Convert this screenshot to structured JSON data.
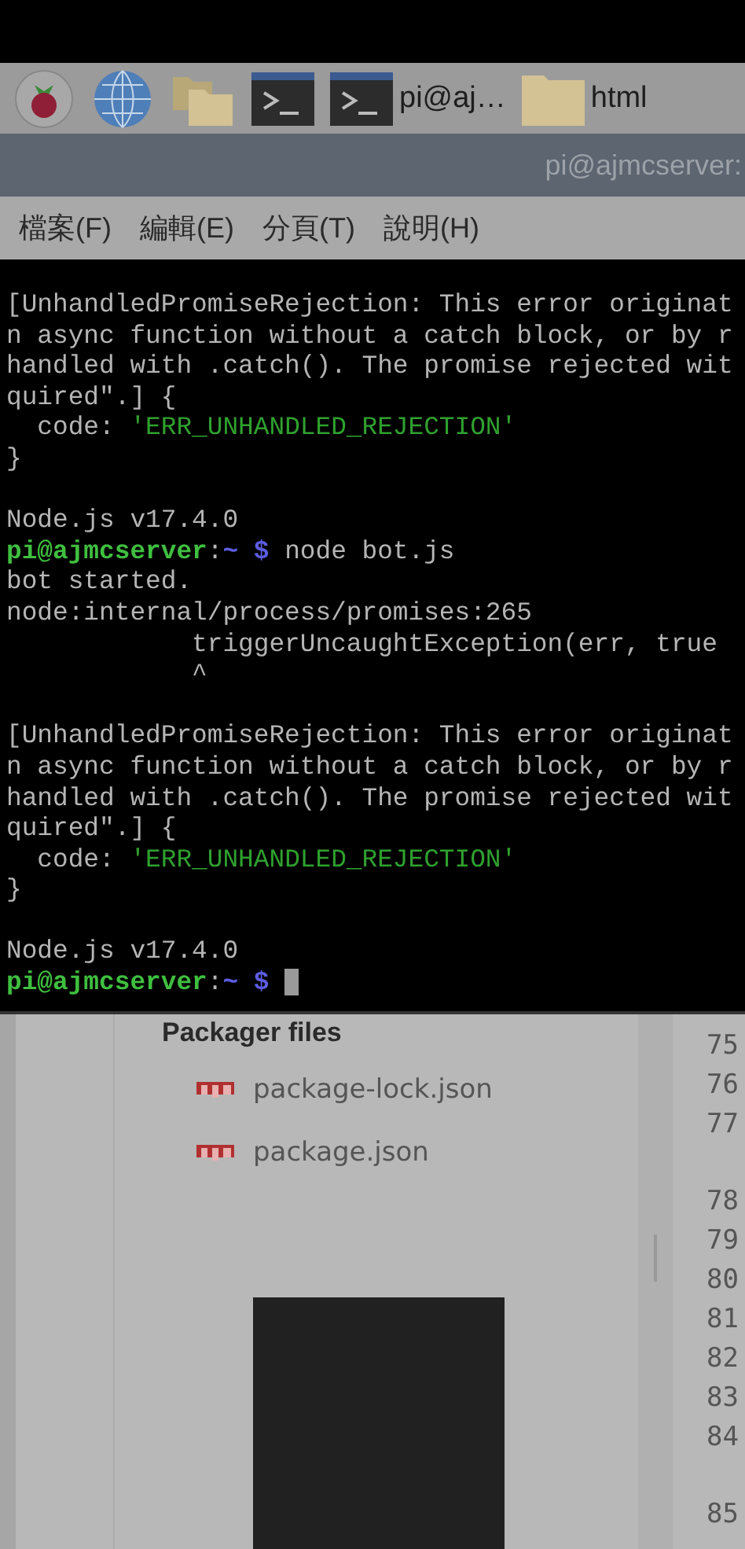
{
  "taskbar": {
    "items": [
      {
        "kind": "menu"
      },
      {
        "kind": "browser"
      },
      {
        "kind": "files"
      },
      {
        "kind": "terminal"
      },
      {
        "kind": "terminal",
        "label": "pi@aj…"
      },
      {
        "kind": "folder",
        "label": "html"
      }
    ]
  },
  "window": {
    "title": "pi@ajmcserver:"
  },
  "menu": [
    "檔案(F)",
    "編輯(E)",
    "分頁(T)",
    "說明(H)"
  ],
  "terminal": {
    "blocks": [
      [
        {
          "segments": [
            {
              "kind": "text",
              "text": "[UnhandledPromiseRejection: This error originat"
            }
          ]
        },
        {
          "segments": [
            {
              "kind": "text",
              "text": "n async function without a catch block, or by r"
            }
          ]
        },
        {
          "segments": [
            {
              "kind": "text",
              "text": "handled with .catch(). The promise rejected wit"
            }
          ]
        },
        {
          "segments": [
            {
              "kind": "text",
              "text": "quired\".] {"
            }
          ]
        },
        {
          "segments": [
            {
              "kind": "text",
              "text": "  code: "
            },
            {
              "kind": "string",
              "text": "'ERR_UNHANDLED_REJECTION'"
            }
          ]
        },
        {
          "segments": [
            {
              "kind": "text",
              "text": "}"
            }
          ]
        }
      ],
      [
        {
          "segments": [
            {
              "kind": "text",
              "text": "Node.js v17.4.0"
            }
          ]
        },
        {
          "segments": [
            {
              "kind": "user",
              "text": "pi@ajmcserver"
            },
            {
              "kind": "text",
              "text": ":"
            },
            {
              "kind": "path",
              "text": "~ $"
            },
            {
              "kind": "text",
              "text": " node bot.js"
            }
          ]
        },
        {
          "segments": [
            {
              "kind": "text",
              "text": "bot started."
            }
          ]
        },
        {
          "segments": [
            {
              "kind": "text",
              "text": "node:internal/process/promises:265"
            }
          ]
        },
        {
          "segments": [
            {
              "kind": "text",
              "text": "            triggerUncaughtException(err, true"
            }
          ]
        },
        {
          "segments": [
            {
              "kind": "text",
              "text": "            ^"
            }
          ]
        }
      ],
      [
        {
          "segments": [
            {
              "kind": "text",
              "text": "[UnhandledPromiseRejection: This error originat"
            }
          ]
        },
        {
          "segments": [
            {
              "kind": "text",
              "text": "n async function without a catch block, or by r"
            }
          ]
        },
        {
          "segments": [
            {
              "kind": "text",
              "text": "handled with .catch(). The promise rejected wit"
            }
          ]
        },
        {
          "segments": [
            {
              "kind": "text",
              "text": "quired\".] {"
            }
          ]
        },
        {
          "segments": [
            {
              "kind": "text",
              "text": "  code: "
            },
            {
              "kind": "string",
              "text": "'ERR_UNHANDLED_REJECTION'"
            }
          ]
        },
        {
          "segments": [
            {
              "kind": "text",
              "text": "}"
            }
          ]
        }
      ],
      [
        {
          "segments": [
            {
              "kind": "text",
              "text": "Node.js v17.4.0"
            }
          ]
        },
        {
          "segments": [
            {
              "kind": "user",
              "text": "pi@ajmcserver"
            },
            {
              "kind": "text",
              "text": ":"
            },
            {
              "kind": "path",
              "text": "~ $"
            }
          ],
          "cursor": true
        }
      ]
    ]
  },
  "background": {
    "heading": "Packager files",
    "files": [
      "package-lock.json",
      "package.json"
    ],
    "line_number_groups": [
      [
        "75",
        "76",
        "77"
      ],
      [
        "78",
        "79",
        "80",
        "81",
        "82",
        "83",
        "84"
      ],
      [
        "85"
      ]
    ]
  }
}
